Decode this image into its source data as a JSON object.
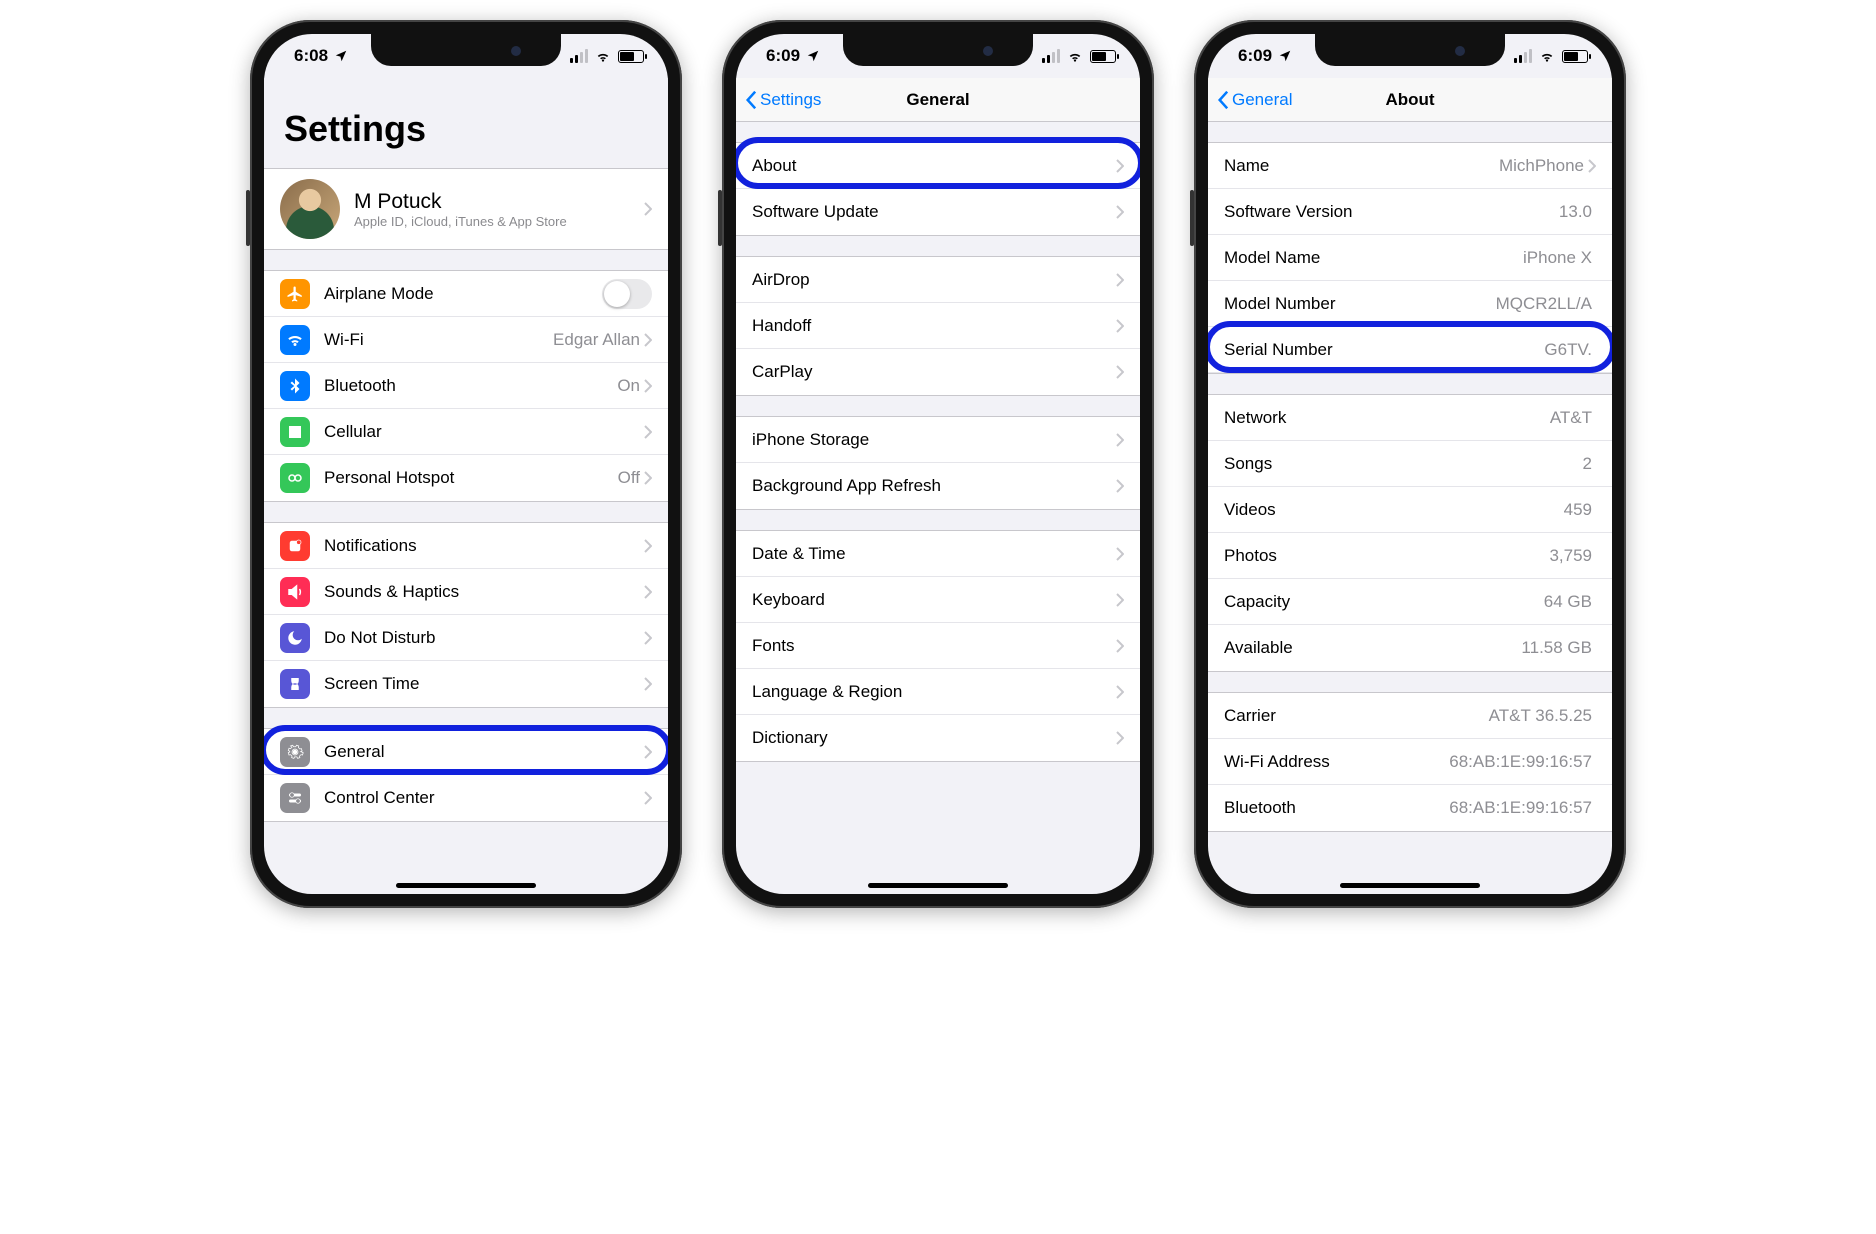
{
  "screen1": {
    "time": "6:08",
    "title": "Settings",
    "profile": {
      "name": "M Potuck",
      "sub": "Apple ID, iCloud, iTunes & App Store"
    },
    "rows": {
      "airplane": "Airplane Mode",
      "wifi": "Wi-Fi",
      "wifi_val": "Edgar Allan",
      "bluetooth": "Bluetooth",
      "bluetooth_val": "On",
      "cellular": "Cellular",
      "hotspot": "Personal Hotspot",
      "hotspot_val": "Off",
      "notifications": "Notifications",
      "sounds": "Sounds & Haptics",
      "dnd": "Do Not Disturb",
      "screentime": "Screen Time",
      "general": "General",
      "controlcenter": "Control Center"
    }
  },
  "screen2": {
    "time": "6:09",
    "back": "Settings",
    "title": "General",
    "rows": {
      "about": "About",
      "software": "Software Update",
      "airdrop": "AirDrop",
      "handoff": "Handoff",
      "carplay": "CarPlay",
      "storage": "iPhone Storage",
      "refresh": "Background App Refresh",
      "datetime": "Date & Time",
      "keyboard": "Keyboard",
      "fonts": "Fonts",
      "language": "Language & Region",
      "dictionary": "Dictionary"
    }
  },
  "screen3": {
    "time": "6:09",
    "back": "General",
    "title": "About",
    "rows": {
      "name": "Name",
      "name_val": "MichPhone",
      "swver": "Software Version",
      "swver_val": "13.0",
      "modelname": "Model Name",
      "modelname_val": "iPhone X",
      "modelnum": "Model Number",
      "modelnum_val": "MQCR2LL/A",
      "serial": "Serial Number",
      "serial_val": "G6TV.",
      "network": "Network",
      "network_val": "AT&T",
      "songs": "Songs",
      "songs_val": "2",
      "videos": "Videos",
      "videos_val": "459",
      "photos": "Photos",
      "photos_val": "3,759",
      "capacity": "Capacity",
      "capacity_val": "64 GB",
      "available": "Available",
      "available_val": "11.58 GB",
      "carrier": "Carrier",
      "carrier_val": "AT&T 36.5.25",
      "wifiaddr": "Wi-Fi Address",
      "wifiaddr_val": "68:AB:1E:99:16:57",
      "btaddr": "Bluetooth",
      "btaddr_val": "68:AB:1E:99:16:57"
    }
  }
}
